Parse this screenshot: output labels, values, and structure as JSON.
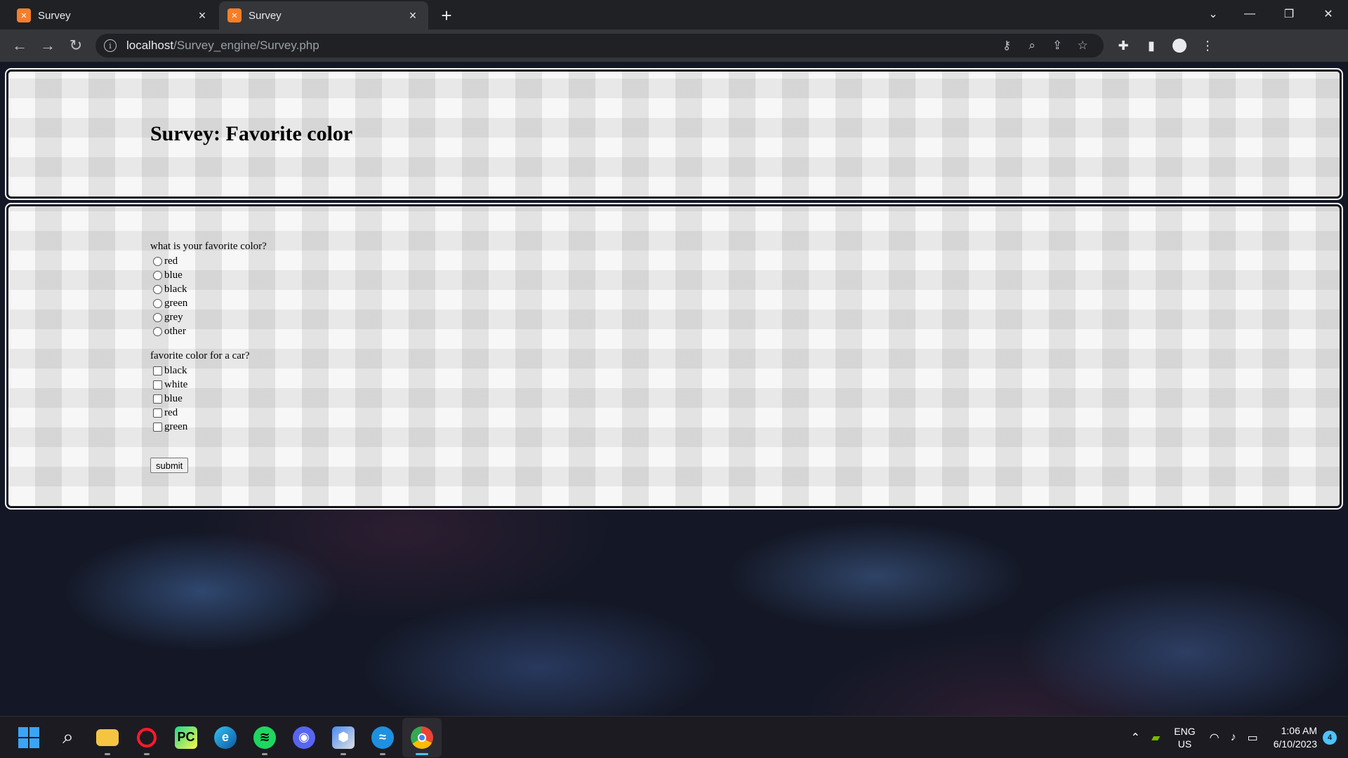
{
  "browser": {
    "tabs": [
      {
        "title": "Survey",
        "favicon": "xampp-icon",
        "active": false
      },
      {
        "title": "Survey",
        "favicon": "xampp-icon",
        "active": true
      }
    ],
    "url_host": "localhost",
    "url_path": "/Survey_engine/Survey.php",
    "icons": {
      "back": "back-arrow-icon",
      "forward": "forward-arrow-icon",
      "reload": "reload-icon",
      "site_info": "info-icon",
      "password": "key-icon",
      "zoom": "zoom-icon",
      "share": "share-icon",
      "bookmark": "star-icon",
      "extensions": "puzzle-icon",
      "side_panel": "side-panel-icon",
      "profile": "profile-icon",
      "menu": "kebab-menu-icon"
    }
  },
  "page": {
    "title": "Survey: Favorite color",
    "question1": {
      "label": "what is your favorite color?",
      "type": "radio",
      "options": [
        "red",
        "blue",
        "black",
        "green",
        "grey",
        "other"
      ]
    },
    "question2": {
      "label": "favorite color for a car?",
      "type": "checkbox",
      "options": [
        "black",
        "white",
        "blue",
        "red",
        "green"
      ]
    },
    "submit_label": "submit"
  },
  "taskbar": {
    "apps": [
      "start",
      "search",
      "file-explorer",
      "opera",
      "pycharm",
      "edge",
      "spotify",
      "discord",
      "shield-app",
      "azure-app",
      "chrome"
    ],
    "language_top": "ENG",
    "language_bottom": "US",
    "time": "1:06 AM",
    "date": "6/10/2023",
    "notification_count": "4"
  },
  "colors": {
    "tab_bar": "#202124",
    "toolbar": "#35363a",
    "xampp_orange": "#f57f2a",
    "taskbar": "#1c1b22",
    "accent": "#4cc2ff"
  }
}
